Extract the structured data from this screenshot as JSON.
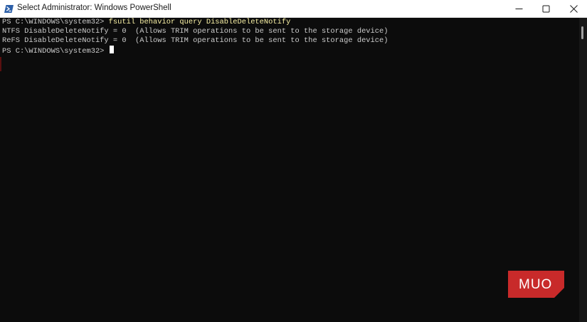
{
  "window": {
    "title": "Select Administrator: Windows PowerShell",
    "controls": {
      "minimize_icon": "minimize-icon",
      "maximize_icon": "maximize-icon",
      "close_icon": "close-icon"
    }
  },
  "console": {
    "prompt": "PS C:\\WINDOWS\\system32> ",
    "command": "fsutil behavior query DisableDeleteNotify",
    "output": [
      "NTFS DisableDeleteNotify = 0  (Allows TRIM operations to be sent to the storage device)",
      "ReFS DisableDeleteNotify = 0  (Allows TRIM operations to be sent to the storage device)"
    ],
    "prompt2": "PS C:\\WINDOWS\\system32> ",
    "colors": {
      "background": "#0c0c0c",
      "text": "#cccccc",
      "command": "#f9f1a5"
    }
  },
  "watermark": {
    "text": "MUO",
    "color": "#c82a2a"
  }
}
